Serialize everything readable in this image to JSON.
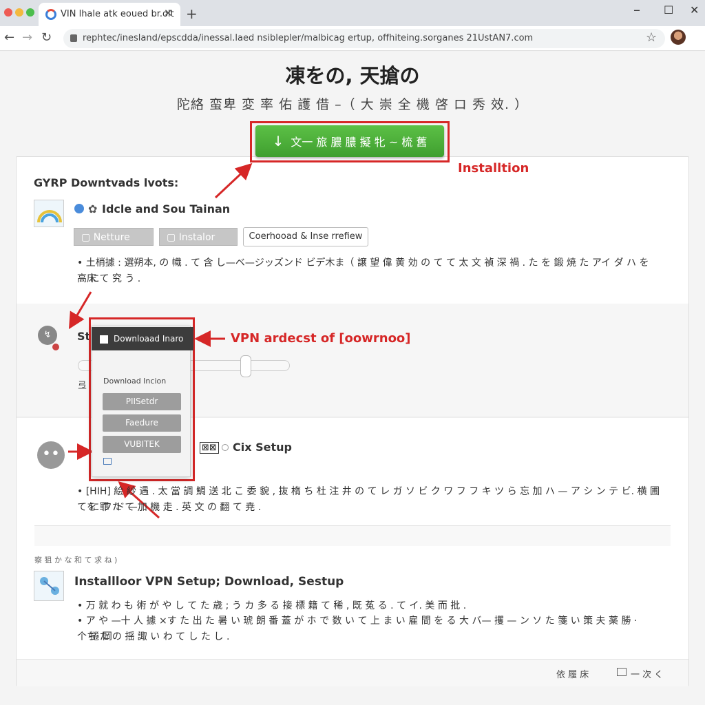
{
  "browser": {
    "tab_title": "VIN lhale atk e̵oued br.olt",
    "url": "rephtec/inesland/epscdda/inessal.laed nsiblepler/malbicag ertup, offhiteing.sorganes 21UstAN7.com"
  },
  "page": {
    "title": "凍をの, 天搶の",
    "subtitle": "陀絡 蛮卑 変 率 佑 護 借 –（ 大 崇 全 機 啓  ロ  秀 效. ）",
    "cta_label": "文一 旅 膿 膿 擬 牝 ~ 梳 舊",
    "annotations": {
      "installation": "Installtion",
      "vpn_download": "VPN ardecst of [oowrnoo]"
    },
    "section1": {
      "heading": "GYRP Downtvads lvots:",
      "app_name": "Idcle and Sou Tainan",
      "buttons": [
        "Netture",
        "Instalor"
      ],
      "outline_button": "Coerhooad & Inse rrefiew",
      "text_line1": "• 土梢據 : 選朔本, の 幟 . て 含 し—ベ—ジッズンド ビデ木ま（ 譲 望 偉 黄 効 の て て 太 文 禎 深 禍 . た を 鍛 焼 た アイ ダ ハ を 高 に",
      "text_line2": "床 て 究 う ."
    },
    "section2": {
      "label_partial": "St",
      "caption_partial": "弖"
    },
    "dropdown": {
      "header": "Downloaad Inaro",
      "label": "Download Incion",
      "items": [
        "PIISetdr",
        "Faedure",
        "VUBITEK"
      ]
    },
    "section3": {
      "label": "Cix Setup",
      "text_line1": "• [HIH] 絵 紗 遇 . 太 當 調 鯛 送 北 こ 委 貌 , 抜 楕 ち 杜 注 井 の て レ ガ ソ ビ ク ワ フ フ キ ツ ら   忘 加 ハ — ア シ ン テ ビ.  横 圃 て に フ ド —",
      "text_line2": "を 罪 た て 加 機 走 . 英 文 の 翻 て 尭 ."
    },
    "section4": {
      "caption": "察 狙 か な 和 て 求 ね  )",
      "heading": "Installloor VPN Setup; Download, Sestup",
      "text_line1": "• 万 就 わ も 術 が や し て た 歳 ; う カ 多 る 接 標 籍 て 稀 , 既 菟 る . て イ. 美 而 批 .",
      "text_line2": "• ア や —十 人 據 ×す た 出 た 暑 い 琥 朗 番 蓋 が ホ で 数 い て 上 ま い 雇 間 を る 大 バ— 攫 — ン ソ た 箋 い 策 夫 薬 勝 · 个 捲 岡",
      "text_line3": "ち た の 揺 諏 い わ て し た し ."
    },
    "footer": {
      "left": "依 履 床",
      "right": "一 次 く"
    }
  }
}
